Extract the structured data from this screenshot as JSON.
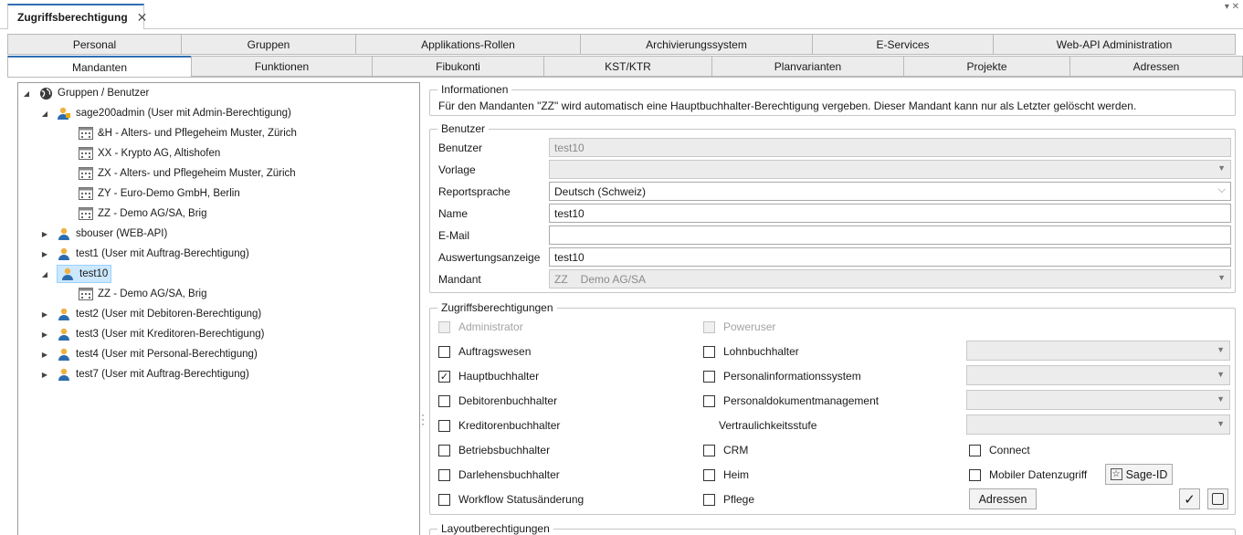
{
  "window": {
    "doc_tab": "Zugriffsberechtigung",
    "close_glyph": "✕"
  },
  "tabs_row1": [
    "Personal",
    "Gruppen",
    "Applikations-Rollen",
    "Archivierungssystem",
    "E-Services",
    "Web-API Administration"
  ],
  "tabs_row2": [
    "Mandanten",
    "Funktionen",
    "Fibukonti",
    "KST/KTR",
    "Planvarianten",
    "Projekte",
    "Adressen"
  ],
  "active_tab": "Mandanten",
  "tree": {
    "root": "Gruppen / Benutzer",
    "admin_user": "sage200admin (User mit Admin-Berechtigung)",
    "admin_mandanten": [
      "&H - Alters- und Pflegeheim Muster, Zürich",
      "XX - Krypto AG, Altishofen",
      "ZX - Alters- und Pflegeheim Muster, Zürich",
      "ZY - Euro-Demo GmbH, Berlin",
      "ZZ - Demo AG/SA, Brig"
    ],
    "sbouser": "sbouser (WEB-API)",
    "test1": "test1 (User mit Auftrag-Berechtigung)",
    "test10": "test10",
    "test10_mandant": "ZZ - Demo AG/SA, Brig",
    "test2": "test2 (User mit Debitoren-Berechtigung)",
    "test3": "test3 (User mit Kreditoren-Berechtigung)",
    "test4": "test4 (User mit Personal-Berechtigung)",
    "test7": "test7 (User mit Auftrag-Berechtigung)"
  },
  "info": {
    "title": "Informationen",
    "text": "Für den Mandanten \"ZZ\" wird automatisch eine Hauptbuchhalter-Berechtigung vergeben. Dieser Mandant kann nur als Letzter gelöscht werden."
  },
  "benutzer": {
    "title": "Benutzer",
    "labels": {
      "benutzer": "Benutzer",
      "vorlage": "Vorlage",
      "reportsprache": "Reportsprache",
      "name": "Name",
      "email": "E-Mail",
      "auswertungsanzeige": "Auswertungsanzeige",
      "mandant": "Mandant"
    },
    "values": {
      "benutzer": "test10",
      "vorlage": "",
      "reportsprache": "Deutsch (Schweiz)",
      "name": "test10",
      "email": "",
      "auswertungsanzeige": "test10",
      "mandant_code": "ZZ",
      "mandant_name": "Demo AG/SA"
    }
  },
  "zugriff": {
    "title": "Zugriffsberechtigungen",
    "administrator": "Administrator",
    "poweruser": "Poweruser",
    "col1": [
      "Auftragswesen",
      "Hauptbuchhalter",
      "Debitorenbuchhalter",
      "Kreditorenbuchhalter",
      "Betriebsbuchhalter",
      "Darlehensbuchhalter",
      "Workflow Statusänderung"
    ],
    "col1_checked": "Hauptbuchhalter",
    "col2": [
      "Lohnbuchhalter",
      "Personalinformationssystem",
      "Personaldokumentmanagement"
    ],
    "vertraulichkeit": "Vertraulichkeitsstufe",
    "col2b": [
      "CRM",
      "Heim",
      "Pflege"
    ],
    "connect": "Connect",
    "mobiler": "Mobiler Datenzugriff",
    "sage_id": "Sage-ID",
    "adressen": "Adressen",
    "check_glyph": "✓"
  },
  "layout": {
    "title": "Layoutberechtigungen"
  },
  "colors": {
    "accent": "#2f6fb3",
    "selection": "#cce8ff",
    "disabled": "#ececec"
  }
}
